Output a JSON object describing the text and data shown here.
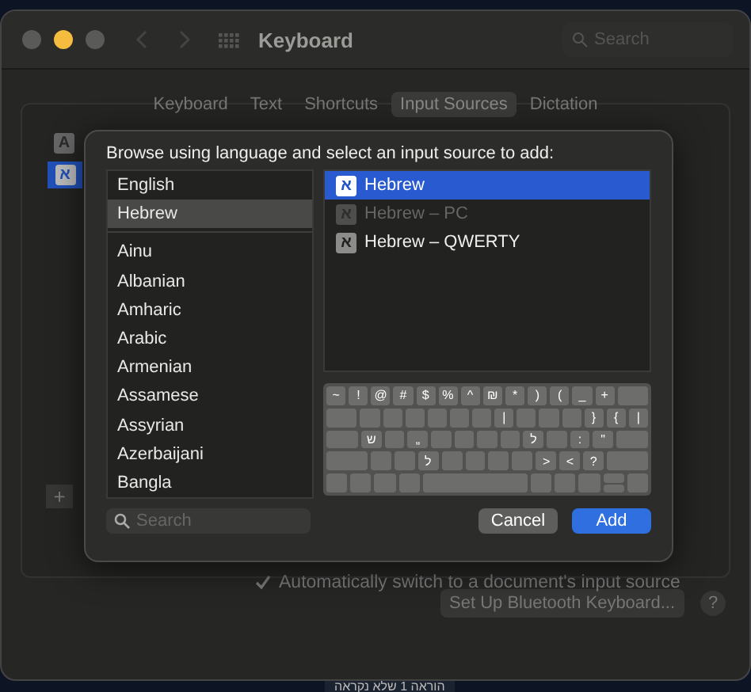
{
  "window": {
    "title": "Keyboard",
    "search": {
      "placeholder": "Search"
    }
  },
  "tabs": [
    {
      "label": "Keyboard",
      "selected": false
    },
    {
      "label": "Text",
      "selected": false
    },
    {
      "label": "Shortcuts",
      "selected": false
    },
    {
      "label": "Input Sources",
      "selected": true
    },
    {
      "label": "Dictation",
      "selected": false
    }
  ],
  "installed_sources": [
    {
      "glyph": "A",
      "selected": false
    },
    {
      "glyph": "א",
      "selected": true
    }
  ],
  "add_button": "+",
  "auto_switch": {
    "label": "Automatically switch to a document's input source",
    "checked": true
  },
  "bluetooth_button": "Set Up Bluetooth Keyboard...",
  "help_button": "?",
  "dialog": {
    "prompt": "Browse using language and select an input source to add:",
    "languages": [
      {
        "label": "English",
        "selected": false
      },
      {
        "label": "Hebrew",
        "selected": true
      },
      {
        "kind": "separator"
      },
      {
        "label": "Ainu",
        "selected": false
      },
      {
        "label": "Albanian",
        "selected": false
      },
      {
        "label": "Amharic",
        "selected": false
      },
      {
        "label": "Arabic",
        "selected": false
      },
      {
        "label": "Armenian",
        "selected": false
      },
      {
        "label": "Assamese",
        "selected": false
      },
      {
        "label": "Assyrian",
        "selected": false
      },
      {
        "label": "Azerbaijani",
        "selected": false
      },
      {
        "label": "Bangla",
        "selected": false
      }
    ],
    "sources": [
      {
        "glyph": "א",
        "label": "Hebrew",
        "selected": true,
        "disabled": false
      },
      {
        "glyph": "א",
        "label": "Hebrew – PC",
        "selected": false,
        "disabled": true
      },
      {
        "glyph": "א",
        "label": "Hebrew – QWERTY",
        "selected": false,
        "disabled": false
      }
    ],
    "keyboard": [
      [
        {
          "label": "~"
        },
        {
          "label": "!"
        },
        {
          "label": "@"
        },
        {
          "label": "#"
        },
        {
          "label": "$"
        },
        {
          "label": "%"
        },
        {
          "label": "^"
        },
        {
          "label": "₪"
        },
        {
          "label": "*"
        },
        {
          "label": ")"
        },
        {
          "label": "("
        },
        {
          "label": "_"
        },
        {
          "label": "+"
        },
        {
          "kind": "wide"
        }
      ],
      [
        {
          "kind": "wide"
        },
        {
          "kind": "key"
        },
        {
          "kind": "key"
        },
        {
          "kind": "key"
        },
        {
          "kind": "key"
        },
        {
          "kind": "key"
        },
        {
          "kind": "key"
        },
        {
          "label": "|"
        },
        {
          "kind": "key"
        },
        {
          "kind": "key"
        },
        {
          "kind": "key"
        },
        {
          "label": "}"
        },
        {
          "label": "{"
        },
        {
          "label": "|"
        }
      ],
      [
        {
          "kind": "wide"
        },
        {
          "label": "ש"
        },
        {
          "kind": "key"
        },
        {
          "label": "„"
        },
        {
          "kind": "key"
        },
        {
          "kind": "key"
        },
        {
          "kind": "key"
        },
        {
          "kind": "key"
        },
        {
          "label": "ל"
        },
        {
          "kind": "key"
        },
        {
          "label": ":"
        },
        {
          "label": "\""
        },
        {
          "kind": "wide"
        }
      ],
      [
        {
          "kind": "xwide"
        },
        {
          "kind": "key"
        },
        {
          "kind": "key"
        },
        {
          "label": "ל"
        },
        {
          "kind": "key"
        },
        {
          "kind": "key"
        },
        {
          "kind": "key"
        },
        {
          "kind": "key"
        },
        {
          "label": ">"
        },
        {
          "label": "<"
        },
        {
          "label": "?"
        },
        {
          "kind": "xwide"
        }
      ],
      [
        {
          "kind": "key"
        },
        {
          "kind": "key"
        },
        {
          "kind": "key"
        },
        {
          "kind": "key"
        },
        {
          "kind": "space"
        },
        {
          "kind": "key"
        },
        {
          "kind": "key"
        },
        {
          "kind": "key"
        },
        {
          "kind": "arrows"
        },
        {
          "kind": "key"
        }
      ]
    ],
    "search": {
      "placeholder": "Search"
    },
    "buttons": [
      {
        "label": "Cancel",
        "kind": "secondary"
      },
      {
        "label": "Add",
        "kind": "primary"
      }
    ]
  },
  "desktop_caption": "הוראה 1 שלא נקראה"
}
